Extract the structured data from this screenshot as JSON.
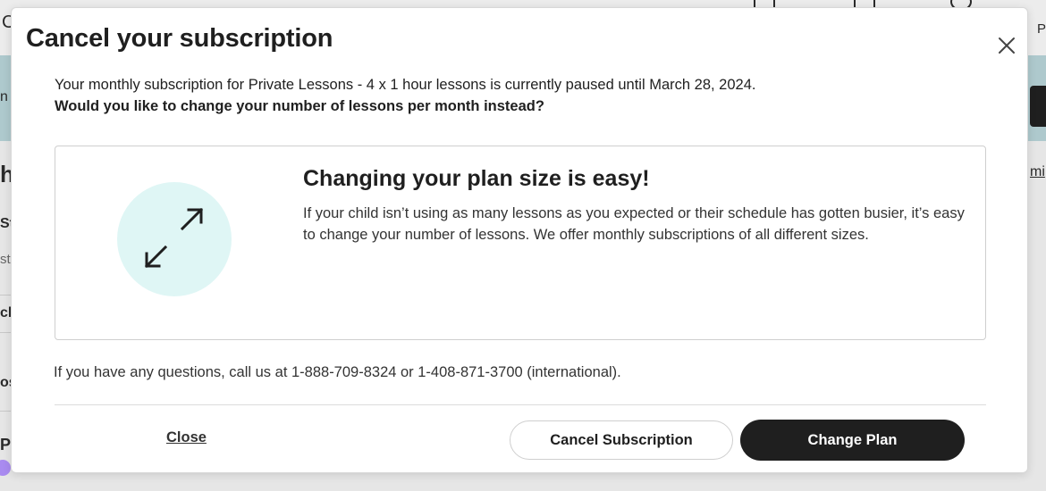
{
  "background": {
    "fragments": {
      "top_left": "C",
      "top_right": "P",
      "band_left": "n",
      "right_link": "mi",
      "h_left": "h",
      "st_bold": "St",
      "st": "st",
      "ch": "ch",
      "os": "os",
      "pr": "Pr"
    }
  },
  "modal": {
    "title": "Cancel your subscription",
    "close_icon": "close-icon",
    "intro_text": "Your monthly subscription for Private Lessons - 4 x 1 hour lessons is currently paused until March 28, 2024.",
    "intro_question": "Would you like to change your number of lessons per month instead?",
    "promo": {
      "icon": "expand-arrows-icon",
      "heading": "Changing your plan size is easy!",
      "body": "If your child isn’t using as many lessons as you expected or their schedule has gotten busier, it’s easy to change your number of lessons. We offer monthly subscriptions of all different sizes."
    },
    "contact_text": "If you have any questions, call us at 1-888-709-8324 or 1-408-871-3700 (international).",
    "buttons": {
      "close_label": "Close",
      "cancel_subscription_label": "Cancel Subscription",
      "change_plan_label": "Change Plan"
    }
  },
  "colors": {
    "accent_dark": "#1f1f1f",
    "promo_circle": "#dff6f5",
    "band": "#aec9cd"
  }
}
